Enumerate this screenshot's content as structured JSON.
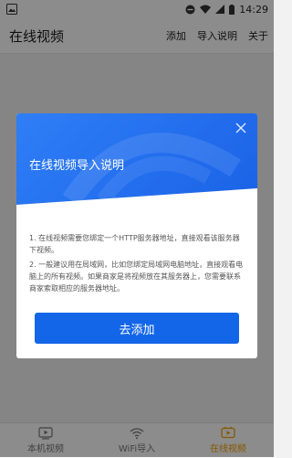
{
  "status_bar": {
    "time": "14:29"
  },
  "app_bar": {
    "title": "在线视频",
    "actions": [
      "添加",
      "导入说明",
      "关于"
    ]
  },
  "bottom_nav": {
    "items": [
      {
        "label": "本机视频",
        "icon": "video-file-icon",
        "active": false
      },
      {
        "label": "WiFi导入",
        "icon": "wifi-icon",
        "active": false
      },
      {
        "label": "在线视频",
        "icon": "online-video-icon",
        "active": true
      }
    ],
    "active_color": "#f5a100"
  },
  "dialog": {
    "title": "在线视频导入说明",
    "paragraph1": "1. 在线视频需要您绑定一个HTTP服务器地址，直接观看该服务器下视频。",
    "paragraph2": "2. 一般建议用在局域网，比如您绑定局域网电脑地址，直接观看电脑上的所有视频。如果商家是将视频放在其服务器上，您需要联系商家索取相应的服务器地址。",
    "button_label": "去添加",
    "accent_color": "#1366e8"
  }
}
